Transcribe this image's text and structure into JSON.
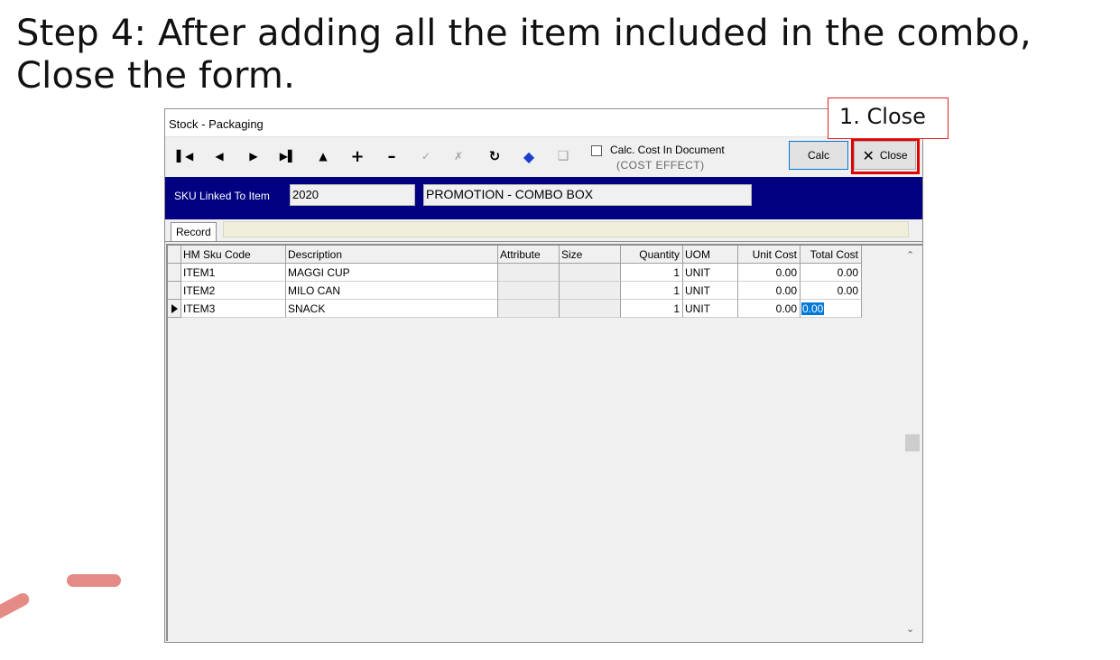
{
  "slide": {
    "title": "Step 4: After adding all the item included in the combo, Close the form."
  },
  "callout": {
    "label": "1. Close"
  },
  "window": {
    "title": "Stock - Packaging",
    "toolbar": {
      "nav_icons": [
        "first-record-icon",
        "prev-record-icon",
        "next-record-icon",
        "last-record-icon",
        "move-up-icon",
        "add-icon",
        "remove-icon",
        "edit-icon",
        "cancel-icon",
        "refresh-icon",
        "tag-icon",
        "goto-icon"
      ],
      "calc_cost_label": "Calc. Cost In Document",
      "calc_cost_sub": "(COST EFFECT)",
      "calc_cost_checked": false,
      "calc_button": "Calc",
      "close_button": "Close"
    },
    "sku": {
      "label": "SKU Linked To Item",
      "code": "2020",
      "description": "PROMOTION - COMBO BOX"
    },
    "tab": {
      "label": "Record"
    },
    "grid": {
      "columns": [
        "HM Sku Code",
        "Description",
        "Attribute",
        "Size",
        "Quantity",
        "UOM",
        "Unit Cost",
        "Total Cost"
      ],
      "rows": [
        {
          "sku": "ITEM1",
          "description": "MAGGI CUP",
          "attribute": "",
          "size": "",
          "quantity": "1",
          "uom": "UNIT",
          "unit_cost": "0.00",
          "total_cost": "0.00"
        },
        {
          "sku": "ITEM2",
          "description": "MILO CAN",
          "attribute": "",
          "size": "",
          "quantity": "1",
          "uom": "UNIT",
          "unit_cost": "0.00",
          "total_cost": "0.00"
        },
        {
          "sku": "ITEM3",
          "description": "SNACK",
          "attribute": "",
          "size": "",
          "quantity": "1",
          "uom": "UNIT",
          "unit_cost": "0.00",
          "total_cost": "0.00"
        }
      ],
      "current_row": 2
    },
    "colors": {
      "sku_bar": "#000080",
      "highlight": "#e00000",
      "selection": "#0078d7"
    }
  }
}
